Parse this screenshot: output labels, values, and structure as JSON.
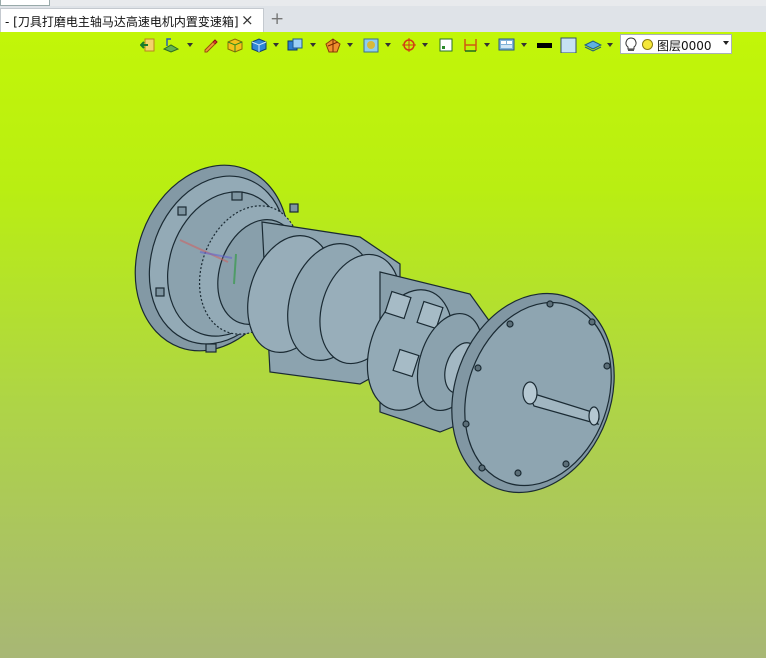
{
  "window": {
    "tab_title": "- [刀具打磨电主轴马达高速电机内置变速箱]",
    "close_icon": "×",
    "new_tab_icon": "+"
  },
  "toolbar": {
    "buttons": [
      {
        "name": "exit-sketch-icon"
      },
      {
        "name": "sketch-plane-icon"
      },
      {
        "name": "pencil-icon"
      },
      {
        "name": "solid-shade-icon"
      },
      {
        "name": "view-cube-icon"
      },
      {
        "name": "render-mode-icon"
      },
      {
        "name": "section-view-icon"
      },
      {
        "name": "texture-icon"
      },
      {
        "name": "snap-icon"
      },
      {
        "name": "frame-icon"
      },
      {
        "name": "dimension-icon"
      },
      {
        "name": "display-filter-icon"
      },
      {
        "name": "line-color-icon"
      },
      {
        "name": "fill-color-icon"
      },
      {
        "name": "layer-manager-icon"
      }
    ],
    "layer": {
      "label": "图层0000",
      "bulb_icon": "bulb-icon",
      "state_icon": "layer-on-icon"
    }
  },
  "viewport": {
    "background_top": "#c2f608",
    "background_bottom": "#a8b775",
    "model_color": "#8ba2ae"
  }
}
